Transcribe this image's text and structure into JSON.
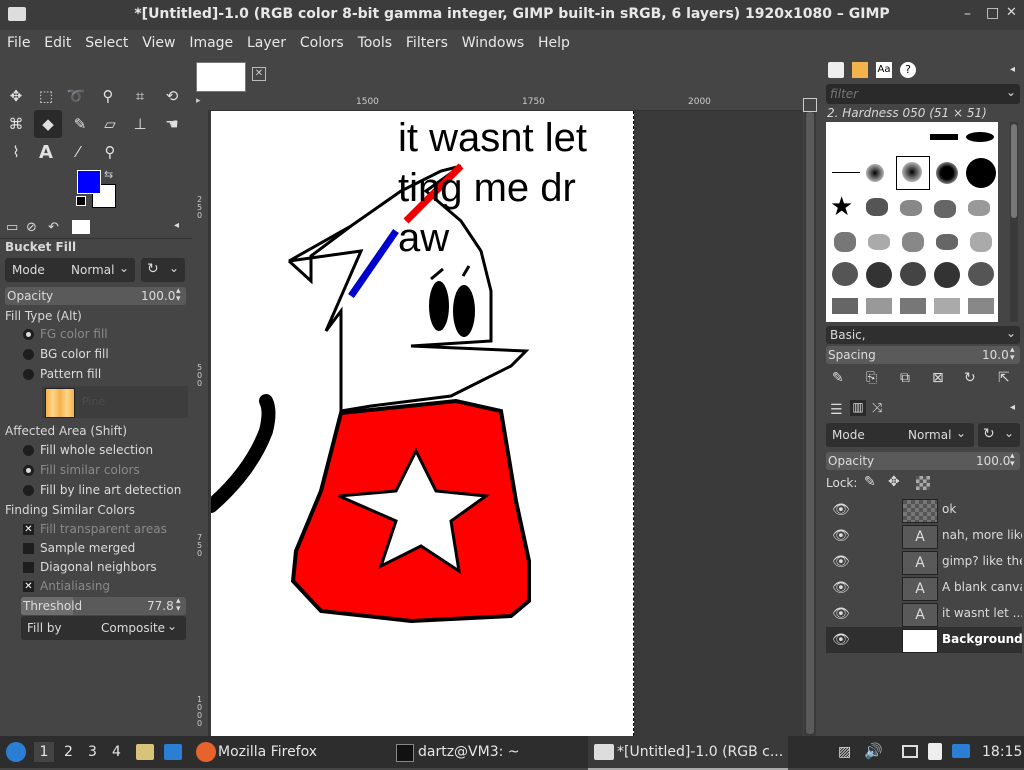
{
  "window": {
    "title": "*[Untitled]-1.0 (RGB color 8-bit gamma integer, GIMP built-in sRGB, 6 layers) 1920x1080 – GIMP",
    "minimize": "–",
    "maximize": "□",
    "close": "✕"
  },
  "menu": [
    "File",
    "Edit",
    "Select",
    "View",
    "Image",
    "Layer",
    "Colors",
    "Tools",
    "Filters",
    "Windows",
    "Help"
  ],
  "ruler": {
    "t1500": "1500",
    "t1750": "1750",
    "t2000": "2000",
    "v250": "2\n5\n0",
    "v500": "5\n0\n0",
    "v750": "7\n5\n0",
    "v1000": "1\n0\n0\n0"
  },
  "canvas_text": [
    "it wasnt let",
    "ting me dr",
    "aw"
  ],
  "tool_options": {
    "title": "Bucket Fill",
    "mode_label": "Mode",
    "mode_value": "Normal",
    "opacity_label": "Opacity",
    "opacity_value": "100.0",
    "fill_type_label": "Fill Type  (Alt)",
    "fill_fg": "FG color fill",
    "fill_bg": "BG color fill",
    "fill_pattern": "Pattern fill",
    "pattern_name": "Pine",
    "affected_label": "Affected Area  (Shift)",
    "area_whole": "Fill whole selection",
    "area_similar": "Fill similar colors",
    "area_lineart": "Fill by line art detection",
    "finding_label": "Finding Similar Colors",
    "fill_transparent": "Fill transparent areas",
    "sample_merged": "Sample merged",
    "diagonal": "Diagonal neighbors",
    "antialiasing": "Antialiasing",
    "threshold_label": "Threshold",
    "threshold_value": "77.8",
    "fill_by_label": "Fill by",
    "fill_by_value": "Composite"
  },
  "colors": {
    "fg": "#0000ff",
    "bg": "#ffffff",
    "accent": "#ff0000"
  },
  "brushes": {
    "filter_placeholder": "filter",
    "selected": "2. Hardness 050 (51 × 51)",
    "preset": "Basic,",
    "spacing_label": "Spacing",
    "spacing_value": "10.0"
  },
  "layers": {
    "mode_label": "Mode",
    "mode_value": "Normal",
    "opacity_label": "Opacity",
    "opacity_value": "100.0",
    "lock_label": "Lock:",
    "items": [
      {
        "name": "ok"
      },
      {
        "name": "nah, more like"
      },
      {
        "name": "gimp? like the"
      },
      {
        "name": "A blank canva"
      },
      {
        "name": "it wasnt let ..."
      },
      {
        "name": "Background"
      }
    ]
  },
  "taskbar": {
    "ws1": "1",
    "ws2": "2",
    "ws3": "3",
    "ws4": "4",
    "firefox": "Mozilla Firefox",
    "terminal": "dartz@VM3: ~",
    "gimp": "*[Untitled]-1.0 (RGB c...",
    "time": "18:15"
  }
}
